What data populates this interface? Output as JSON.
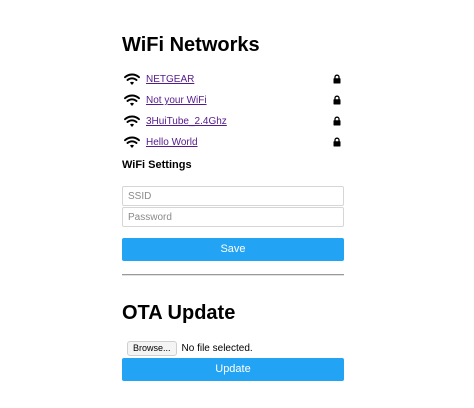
{
  "wifi": {
    "title": "WiFi Networks",
    "networks": [
      {
        "ssid": "NETGEAR",
        "secured": true
      },
      {
        "ssid": "Not your WiFi",
        "secured": true
      },
      {
        "ssid": "3HuiTube_2.4Ghz",
        "secured": true
      },
      {
        "ssid": "Hello World",
        "secured": true
      }
    ]
  },
  "settings": {
    "title": "WiFi Settings",
    "ssid_placeholder": "SSID",
    "password_placeholder": "Password",
    "save_label": "Save"
  },
  "ota": {
    "title": "OTA Update",
    "browse_label": "Browse...",
    "file_status": "No file selected.",
    "update_label": "Update"
  },
  "colors": {
    "button_bg": "#22a3f3",
    "link": "#551a8b"
  },
  "icons": {
    "network": "wifi-icon",
    "secured": "lock-icon"
  }
}
